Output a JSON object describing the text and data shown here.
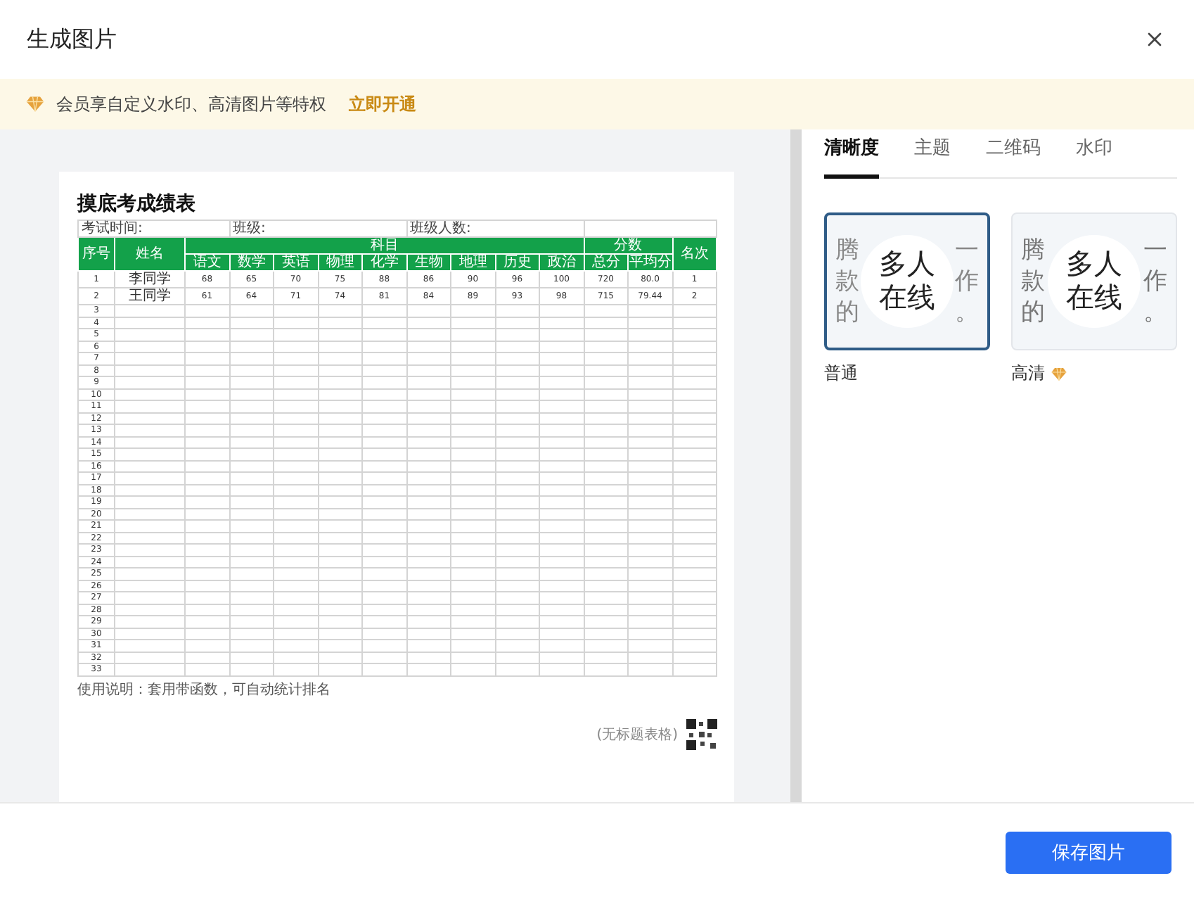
{
  "dialog": {
    "title": "生成图片"
  },
  "banner": {
    "text": "会员享自定义水印、高清图片等特权",
    "link": "立即开通"
  },
  "preview": {
    "title": "摸底考成绩表",
    "info": [
      {
        "label": "考试时间:"
      },
      {
        "label": "班级:"
      },
      {
        "label": "班级人数:"
      }
    ],
    "head_top": [
      {
        "label": "序号",
        "kind": "single"
      },
      {
        "label": "姓名",
        "kind": "single"
      },
      {
        "label": "科目",
        "kind": "group",
        "children": [
          "语文",
          "数学",
          "英语",
          "物理",
          "化学",
          "生物",
          "地理",
          "历史",
          "政治"
        ]
      },
      {
        "label": "分数",
        "kind": "group",
        "children": [
          "总分",
          "平均分"
        ]
      },
      {
        "label": "名次",
        "kind": "single"
      }
    ],
    "rows": [
      {
        "cells": [
          "1",
          "李同学",
          "68",
          "65",
          "70",
          "75",
          "88",
          "86",
          "90",
          "96",
          "100",
          "720",
          "80.0",
          "1"
        ]
      },
      {
        "cells": [
          "2",
          "王同学",
          "61",
          "64",
          "71",
          "74",
          "81",
          "84",
          "89",
          "93",
          "98",
          "715",
          "79.44",
          "2"
        ]
      },
      {
        "cells": [
          "3"
        ]
      },
      {
        "cells": [
          "4"
        ]
      },
      {
        "cells": [
          "5"
        ]
      },
      {
        "cells": [
          "6"
        ]
      },
      {
        "cells": [
          "7"
        ]
      },
      {
        "cells": [
          "8"
        ]
      },
      {
        "cells": [
          "9"
        ]
      },
      {
        "cells": [
          "10"
        ]
      },
      {
        "cells": [
          "11"
        ]
      },
      {
        "cells": [
          "12"
        ]
      },
      {
        "cells": [
          "13"
        ]
      },
      {
        "cells": [
          "14"
        ]
      },
      {
        "cells": [
          "15"
        ]
      },
      {
        "cells": [
          "16"
        ]
      },
      {
        "cells": [
          "17"
        ]
      },
      {
        "cells": [
          "18"
        ]
      },
      {
        "cells": [
          "19"
        ]
      },
      {
        "cells": [
          "20"
        ]
      },
      {
        "cells": [
          "21"
        ]
      },
      {
        "cells": [
          "22"
        ]
      },
      {
        "cells": [
          "23"
        ]
      },
      {
        "cells": [
          "24"
        ]
      },
      {
        "cells": [
          "25"
        ]
      },
      {
        "cells": [
          "26"
        ]
      },
      {
        "cells": [
          "27"
        ]
      },
      {
        "cells": [
          "28"
        ]
      },
      {
        "cells": [
          "29"
        ]
      },
      {
        "cells": [
          "30"
        ]
      },
      {
        "cells": [
          "31"
        ]
      },
      {
        "cells": [
          "32"
        ]
      },
      {
        "cells": [
          "33"
        ]
      }
    ],
    "note": "使用说明：套用带函数，可自动统计排名",
    "doc_label": "(无标题表格)"
  },
  "tabs": [
    {
      "label": "清晰度",
      "selected": true
    },
    {
      "label": "主题",
      "selected": false
    },
    {
      "label": "二维码",
      "selected": false
    },
    {
      "label": "水印",
      "selected": false
    }
  ],
  "options": [
    {
      "label": "普通",
      "selected": true,
      "premium": false,
      "sample_left": [
        "腾",
        "款",
        "的"
      ],
      "sample_right": [
        "一",
        "作",
        "。"
      ],
      "badge": "多人在线"
    },
    {
      "label": "高清",
      "selected": false,
      "premium": true,
      "sample_left": [
        "腾",
        "款",
        "的"
      ],
      "sample_right": [
        "一",
        "作",
        "。"
      ],
      "badge": "多人在线"
    }
  ],
  "save_button": "保存图片"
}
